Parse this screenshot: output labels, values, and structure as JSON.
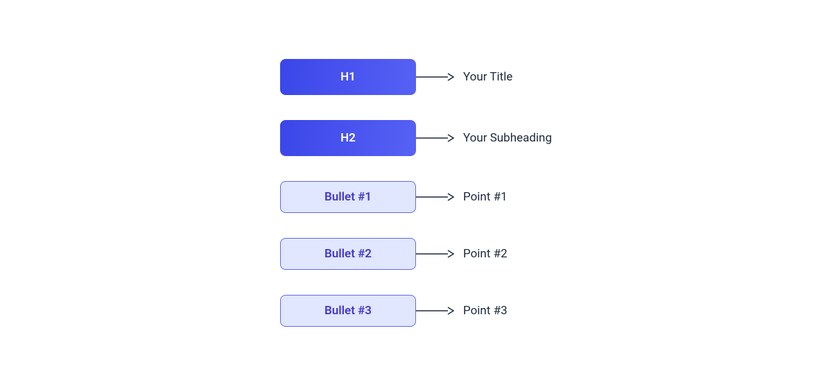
{
  "rows": [
    {
      "box_label": "H1",
      "box_type": "heading",
      "description": "Your Title"
    },
    {
      "box_label": "H2",
      "box_type": "heading",
      "description": "Your Subheading"
    },
    {
      "box_label": "Bullet #1",
      "box_type": "bullet",
      "description": "Point #1"
    },
    {
      "box_label": "Bullet #2",
      "box_type": "bullet",
      "description": "Point #2"
    },
    {
      "box_label": "Bullet #3",
      "box_type": "bullet",
      "description": "Point #3"
    }
  ]
}
